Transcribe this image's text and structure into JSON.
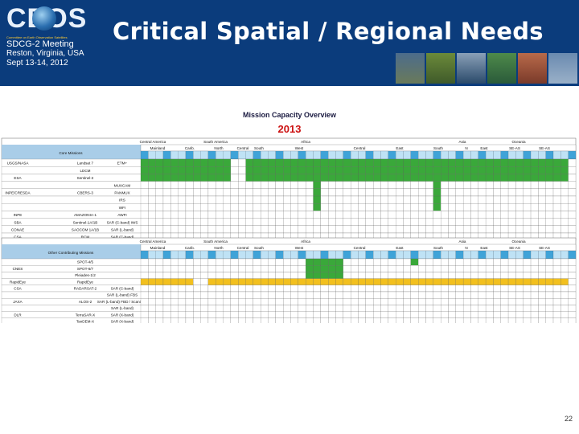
{
  "header": {
    "logo_text": "CEOS",
    "logo_subtitle": "Committee on Earth Observation Satellites",
    "meeting_line1": "SDCG-2 Meeting",
    "meeting_line2": "Reston, Virginia, USA",
    "meeting_line3": "Sept 13-14, 2012",
    "title": "Critical Spatial / Regional Needs"
  },
  "table": {
    "title": "Mission Capacity Overview",
    "year": "2013",
    "regions_top": [
      "Central America",
      "South America",
      "Africa",
      "Asia",
      "Oceania"
    ],
    "subregions": [
      "Mainland",
      "Carib.",
      "North",
      "Central",
      "South",
      "West",
      "Central",
      "East",
      "South",
      "N",
      "East",
      "SE-AS",
      "SE-AS"
    ],
    "core_header": "Core Missions",
    "other_header": "Other Contributing Missions",
    "core_rows": [
      {
        "agency": "USGS/NASA",
        "mission": "Landsat 7",
        "sensor": "ETM+"
      },
      {
        "agency": "",
        "mission": "LDCM",
        "sensor": ""
      },
      {
        "agency": "ESA",
        "mission": "Sentinel-2",
        "sensor": ""
      },
      {
        "agency": "",
        "mission": "",
        "sensor": "MUXCAM"
      },
      {
        "agency": "INPE/CRESDA",
        "mission": "CBERS-3",
        "sensor": "PANMUX"
      },
      {
        "agency": "",
        "mission": "",
        "sensor": "IRS"
      },
      {
        "agency": "",
        "mission": "",
        "sensor": "WFI"
      },
      {
        "agency": "INPE",
        "mission": "AMAZONIA-1",
        "sensor": "AWFI"
      },
      {
        "agency": "SBA",
        "mission": "Sentinel-1A/1B",
        "sensor": "SAR (C-band) IWS"
      },
      {
        "agency": "CONAE",
        "mission": "SAOCOM 1A/1B",
        "sensor": "SAR (L-band)"
      },
      {
        "agency": "CSA",
        "mission": "RCM",
        "sensor": "SAR (C-band)"
      }
    ],
    "other_rows": [
      {
        "agency": "",
        "mission": "SPOT-4/5",
        "sensor": ""
      },
      {
        "agency": "CNES",
        "mission": "SPOT-6/7",
        "sensor": ""
      },
      {
        "agency": "",
        "mission": "Pleiades-1/2",
        "sensor": ""
      },
      {
        "agency": "RapidEye",
        "mission": "RapidEye",
        "sensor": ""
      },
      {
        "agency": "CSA",
        "mission": "RADARSAT-2",
        "sensor": "SAR (C-band)"
      },
      {
        "agency": "",
        "mission": "",
        "sensor": "SAR (L-band) FBS"
      },
      {
        "agency": "JAXA",
        "mission": "ALOS-2",
        "sensor": "SAR (L-band) FBD / ScanSAR"
      },
      {
        "agency": "",
        "mission": "",
        "sensor": "SAR (L-band)"
      },
      {
        "agency": "DLR",
        "mission": "TerraSAR-X",
        "sensor": "SAR (X-band)"
      },
      {
        "agency": "",
        "mission": "TanDEM-X",
        "sensor": "SAR (X-band)"
      }
    ]
  },
  "footer": {
    "page_number": "22"
  },
  "colors": {
    "header_bg": "#0b3c7c",
    "title_red": "#cc1111",
    "coverage_green": "#3aa83a",
    "partial_yellow": "#f2c01e",
    "subheader_blue": "#a9cde8"
  }
}
